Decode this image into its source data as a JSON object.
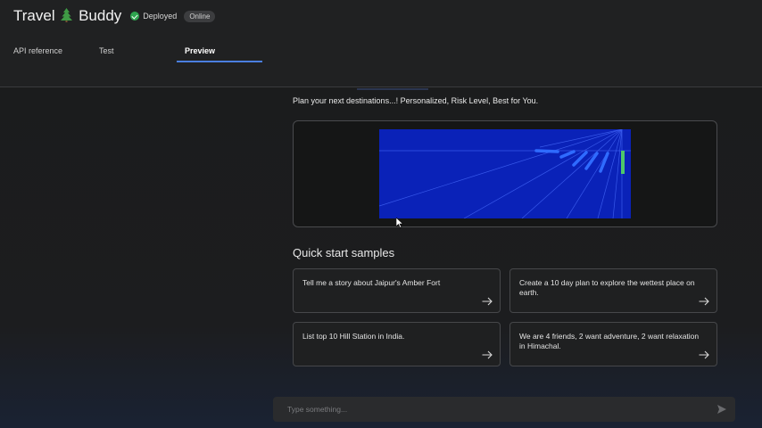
{
  "app": {
    "title_part1": "Travel",
    "title_icon": "tree-icon",
    "title_part2": "Buddy",
    "status_text": "Deployed",
    "status_icon": "check-circle-icon",
    "status_color": "#2ea44f",
    "badge": "Online"
  },
  "tabs": [
    {
      "label": "API reference",
      "active": false
    },
    {
      "label": "Test",
      "active": false
    },
    {
      "label": "Preview",
      "active": true
    }
  ],
  "accent_color": "#4a7fe0",
  "preview": {
    "tagline": "Plan your next destinations...! Personalized, Risk Level, Best for You.",
    "image_icon": "hyperspace-banner-image"
  },
  "quick_start": {
    "title": "Quick start samples",
    "cards": [
      {
        "text": "Tell me a story about Jaipur's Amber Fort"
      },
      {
        "text": "Create a 10 day plan to explore the wettest place on earth."
      },
      {
        "text": "List top 10 Hill Station in India."
      },
      {
        "text": "We are 4 friends, 2 want adventure, 2 want relaxation in Himachal."
      }
    ]
  },
  "composer": {
    "placeholder": "Type something...",
    "send_icon": "send-icon"
  }
}
